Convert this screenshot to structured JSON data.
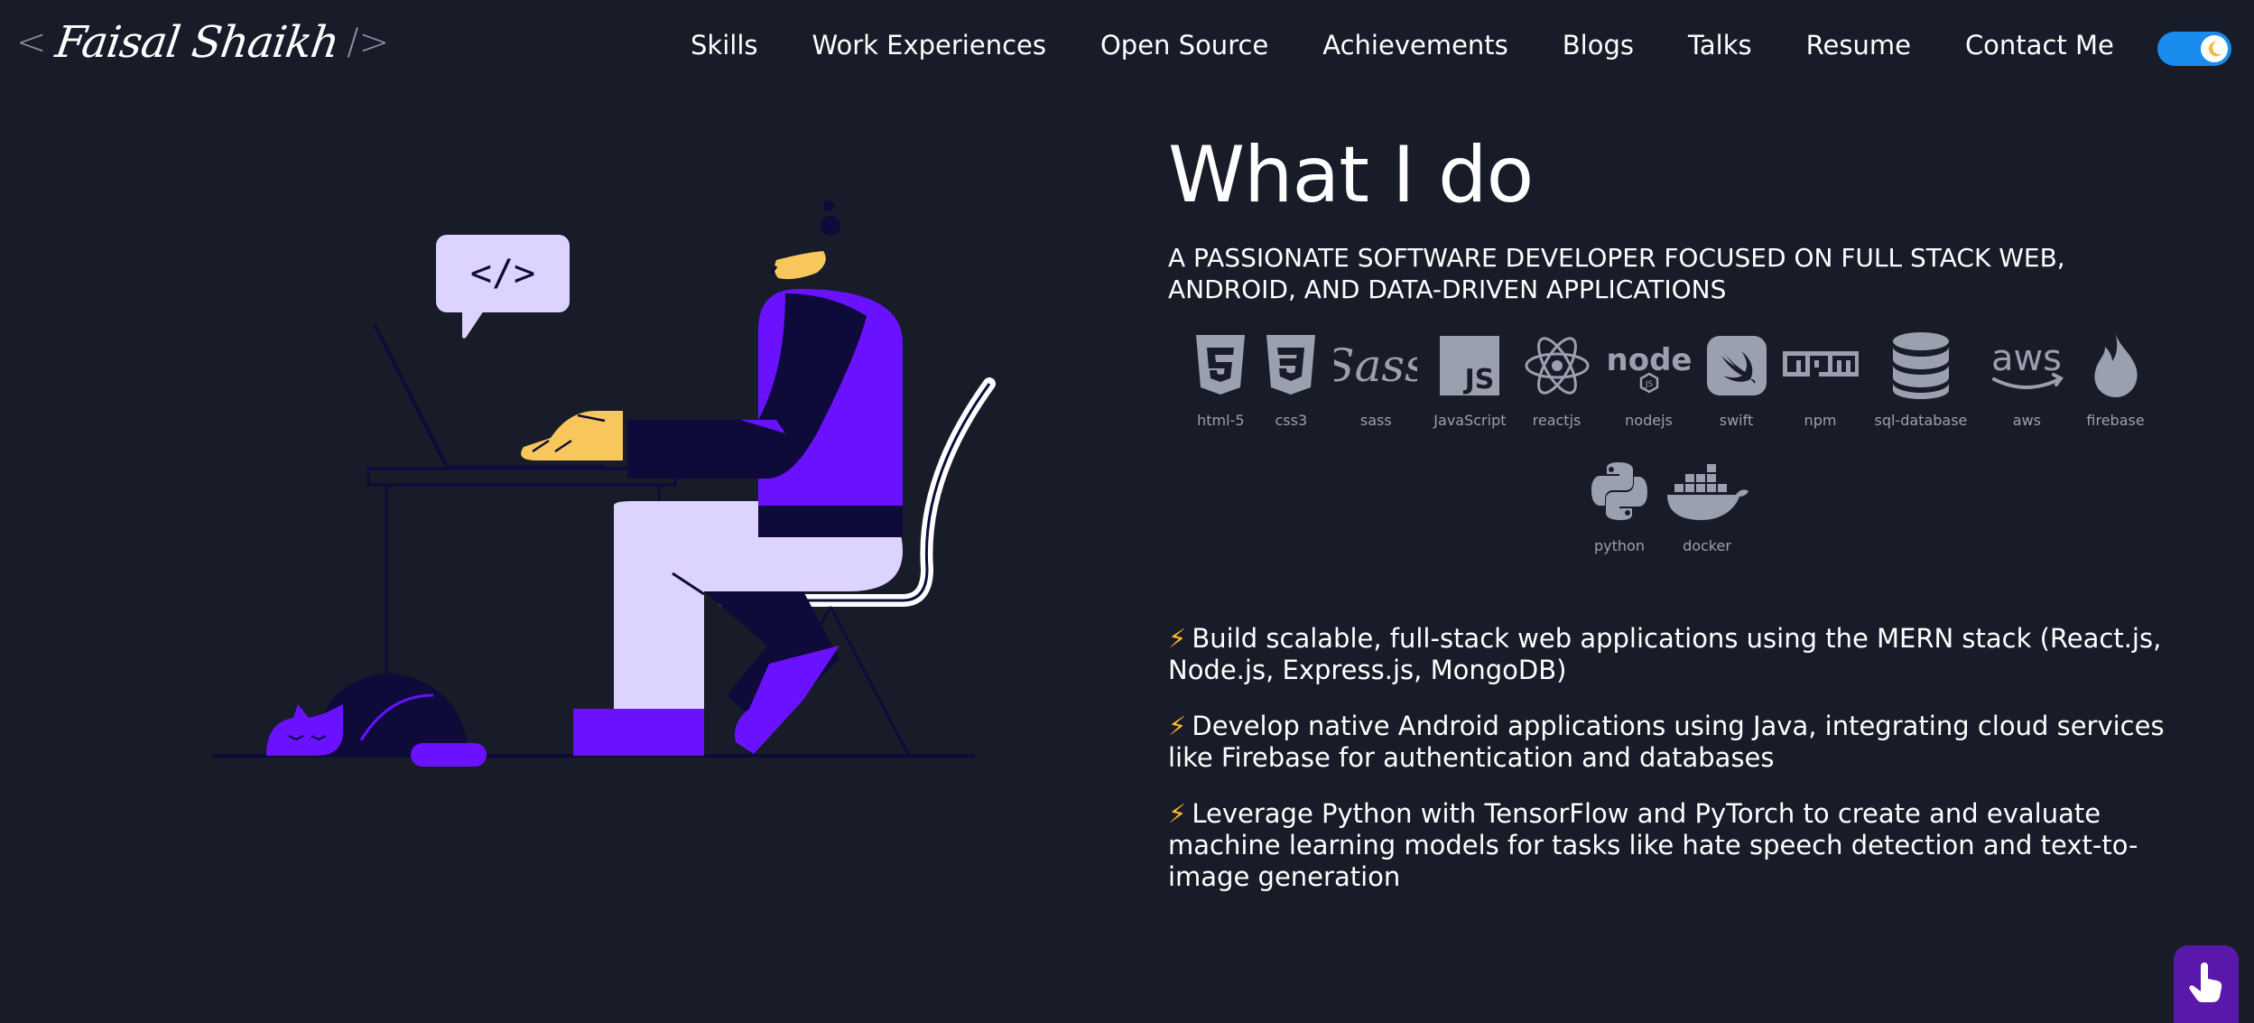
{
  "header": {
    "logo": {
      "bracket_open": "<",
      "name": "Faisal Shaikh",
      "bracket_close": "/>"
    },
    "nav": [
      {
        "label": "Skills"
      },
      {
        "label": "Work Experiences"
      },
      {
        "label": "Open Source"
      },
      {
        "label": "Achievements"
      },
      {
        "label": "Blogs"
      },
      {
        "label": "Talks"
      },
      {
        "label": "Resume"
      },
      {
        "label": "Contact Me"
      }
    ],
    "theme_toggle": {
      "icon": "moon-icon",
      "accent": "#1a8cf0"
    }
  },
  "illustration": {
    "code_bubble": "</>"
  },
  "main": {
    "title": "What I do",
    "subtitle": "A PASSIONATE SOFTWARE DEVELOPER FOCUSED ON FULL STACK WEB, ANDROID, AND DATA-DRIVEN APPLICATIONS",
    "skills": [
      {
        "label": "html-5",
        "icon": "html5-icon"
      },
      {
        "label": "css3",
        "icon": "css3-icon"
      },
      {
        "label": "sass",
        "icon": "sass-icon"
      },
      {
        "label": "JavaScript",
        "icon": "javascript-icon"
      },
      {
        "label": "reactjs",
        "icon": "react-icon"
      },
      {
        "label": "nodejs",
        "icon": "nodejs-icon"
      },
      {
        "label": "swift",
        "icon": "swift-icon"
      },
      {
        "label": "npm",
        "icon": "npm-icon"
      },
      {
        "label": "sql-database",
        "icon": "database-icon"
      },
      {
        "label": "aws",
        "icon": "aws-icon"
      },
      {
        "label": "firebase",
        "icon": "firebase-icon"
      },
      {
        "label": "python",
        "icon": "python-icon"
      },
      {
        "label": "docker",
        "icon": "docker-icon"
      }
    ],
    "bullets": [
      {
        "bolt": "⚡",
        "text": "Build scalable, full-stack web applications using the MERN stack (React.js, Node.js, Express.js, MongoDB)"
      },
      {
        "bolt": "⚡",
        "text": "Develop native Android applications using Java, integrating cloud services like Firebase for authentication and databases"
      },
      {
        "bolt": "⚡",
        "text": "Leverage Python with TensorFlow and PyTorch to create and evaluate machine learning models for tasks like hate speech detection and text-to-image generation"
      }
    ]
  },
  "colors": {
    "background": "#171c28",
    "accent_purple": "#6a11ff",
    "lavender": "#ddd3ff",
    "skin": "#f7c75b",
    "icon_gray": "#9aa0ad",
    "fab": "#5a18aa"
  },
  "fab": {
    "icon": "pointing-hand-icon"
  }
}
